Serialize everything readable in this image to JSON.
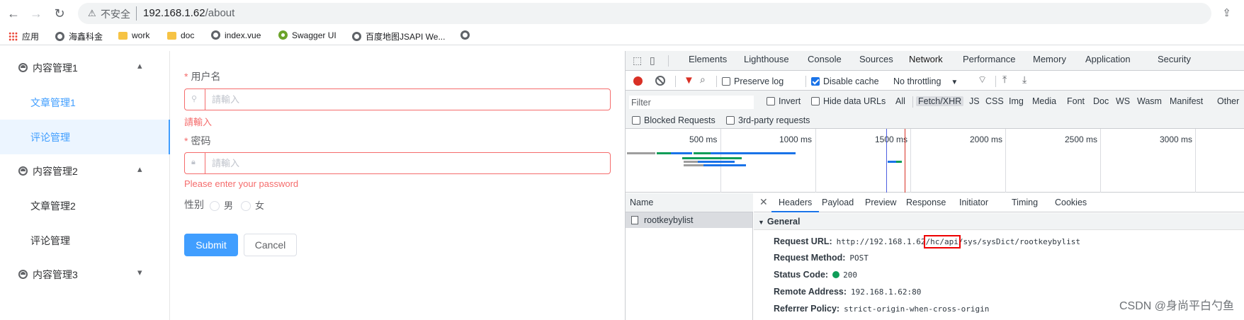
{
  "browser": {
    "insecure_label": "不安全",
    "url_host": "192.168.1.62",
    "url_path": "/about",
    "bookmarks": [
      {
        "label": "应用",
        "icon": "apps-icon"
      },
      {
        "label": "海鑫科金",
        "icon": "globe-icon"
      },
      {
        "label": "work",
        "icon": "folder-icon"
      },
      {
        "label": "doc",
        "icon": "folder-icon"
      },
      {
        "label": "index.vue",
        "icon": "globe-icon"
      },
      {
        "label": "Swagger UI",
        "icon": "swagger-icon"
      },
      {
        "label": "百度地图JSAPI We...",
        "icon": "globe-icon"
      },
      {
        "label": "",
        "icon": "globe-icon"
      }
    ]
  },
  "sidebar": {
    "groups": [
      {
        "label": "内容管理1",
        "expanded": true,
        "arrow": "▴"
      },
      {
        "label": "内容管理2",
        "expanded": true,
        "arrow": "▴"
      },
      {
        "label": "内容管理3",
        "expanded": false,
        "arrow": "▾"
      }
    ],
    "items": [
      {
        "label": "文章管理1",
        "active": false
      },
      {
        "label": "评论管理",
        "active": true
      },
      {
        "label": "文章管理2",
        "active": false
      },
      {
        "label": "评论管理",
        "active": false
      }
    ]
  },
  "form": {
    "required_mark": "*",
    "username_label": "用户名",
    "username_placeholder": "請輸入",
    "username_error": "請輸入",
    "password_label": "密码",
    "password_placeholder": "請輸入",
    "password_error": "Please enter your password",
    "gender_label": "性别",
    "gender_options": [
      "男",
      "女"
    ],
    "submit_label": "Submit",
    "cancel_label": "Cancel"
  },
  "devtools": {
    "tabs": [
      "Elements",
      "Lighthouse",
      "Console",
      "Sources",
      "Network",
      "Performance",
      "Memory",
      "Application",
      "Security"
    ],
    "active_tab": "Network",
    "toolbar": {
      "preserve_log": "Preserve log",
      "disable_cache": "Disable cache",
      "throttling": "No throttling"
    },
    "filter_placeholder": "Filter",
    "filter_options": [
      "Invert",
      "Hide data URLs"
    ],
    "filter_types": [
      "All",
      "Fetch/XHR",
      "JS",
      "CSS",
      "Img",
      "Media",
      "Font",
      "Doc",
      "WS",
      "Wasm",
      "Manifest",
      "Other"
    ],
    "active_filter_type": "Fetch/XHR",
    "request_filters": [
      "Blocked Requests",
      "3rd-party requests"
    ],
    "timeline_ticks": [
      "500 ms",
      "1000 ms",
      "1500 ms",
      "2000 ms",
      "2500 ms",
      "3000 ms"
    ],
    "name_header": "Name",
    "requests": [
      "rootkeybylist"
    ],
    "detail_tabs": [
      "Headers",
      "Payload",
      "Preview",
      "Response",
      "Initiator",
      "Timing",
      "Cookies"
    ],
    "active_detail_tab": "Headers",
    "general_header": "General",
    "general": {
      "request_url_key": "Request URL:",
      "request_url_prefix": "http://192.168.1.62",
      "request_url_highlight": "/hc/api",
      "request_url_suffix": "/sys/sysDict/rootkeybylist",
      "request_method_key": "Request Method:",
      "request_method": "POST",
      "status_code_key": "Status Code:",
      "status_code": "200",
      "remote_address_key": "Remote Address:",
      "remote_address": "192.168.1.62:80",
      "referrer_policy_key": "Referrer Policy:",
      "referrer_policy": "strict-origin-when-cross-origin"
    }
  },
  "watermark": "CSDN @身尚平白勺鱼",
  "colors": {
    "accent": "#409eff",
    "error": "#f56c6c",
    "devtools_blue": "#1a73e8",
    "record_red": "#d93025",
    "status_green": "#0f9d58"
  }
}
